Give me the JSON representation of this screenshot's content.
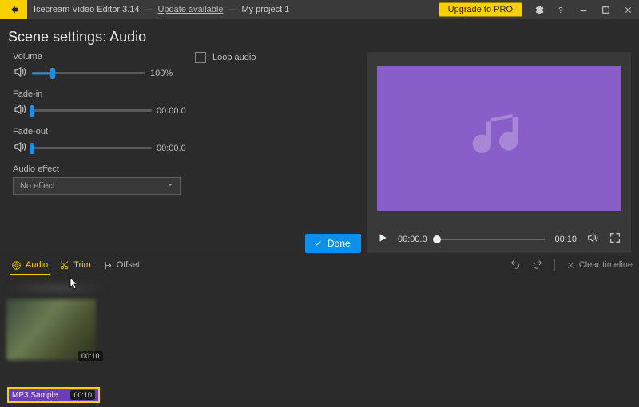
{
  "titlebar": {
    "app_title": "Icecream Video Editor 3.14",
    "update_label": "Update available",
    "project_name": "My project 1",
    "upgrade_label": "Upgrade to PRO"
  },
  "heading": "Scene settings: Audio",
  "controls": {
    "volume_label": "Volume",
    "volume_value": "100%",
    "fadein_label": "Fade-in",
    "fadein_value": "00:00.0",
    "fadeout_label": "Fade-out",
    "fadeout_value": "00:00.0",
    "loop_label": "Loop audio",
    "effect_label": "Audio effect",
    "effect_value": "No effect",
    "done_label": "Done"
  },
  "player": {
    "current_time": "00:00.0",
    "total_time": "00:10"
  },
  "tool_tabs": {
    "audio": "Audio",
    "trim": "Trim",
    "offset": "Offset",
    "clear": "Clear timeline"
  },
  "timeline": {
    "video_duration": "00:10",
    "audio_clip_name": "MP3 Sample",
    "audio_clip_duration": "00:10"
  }
}
